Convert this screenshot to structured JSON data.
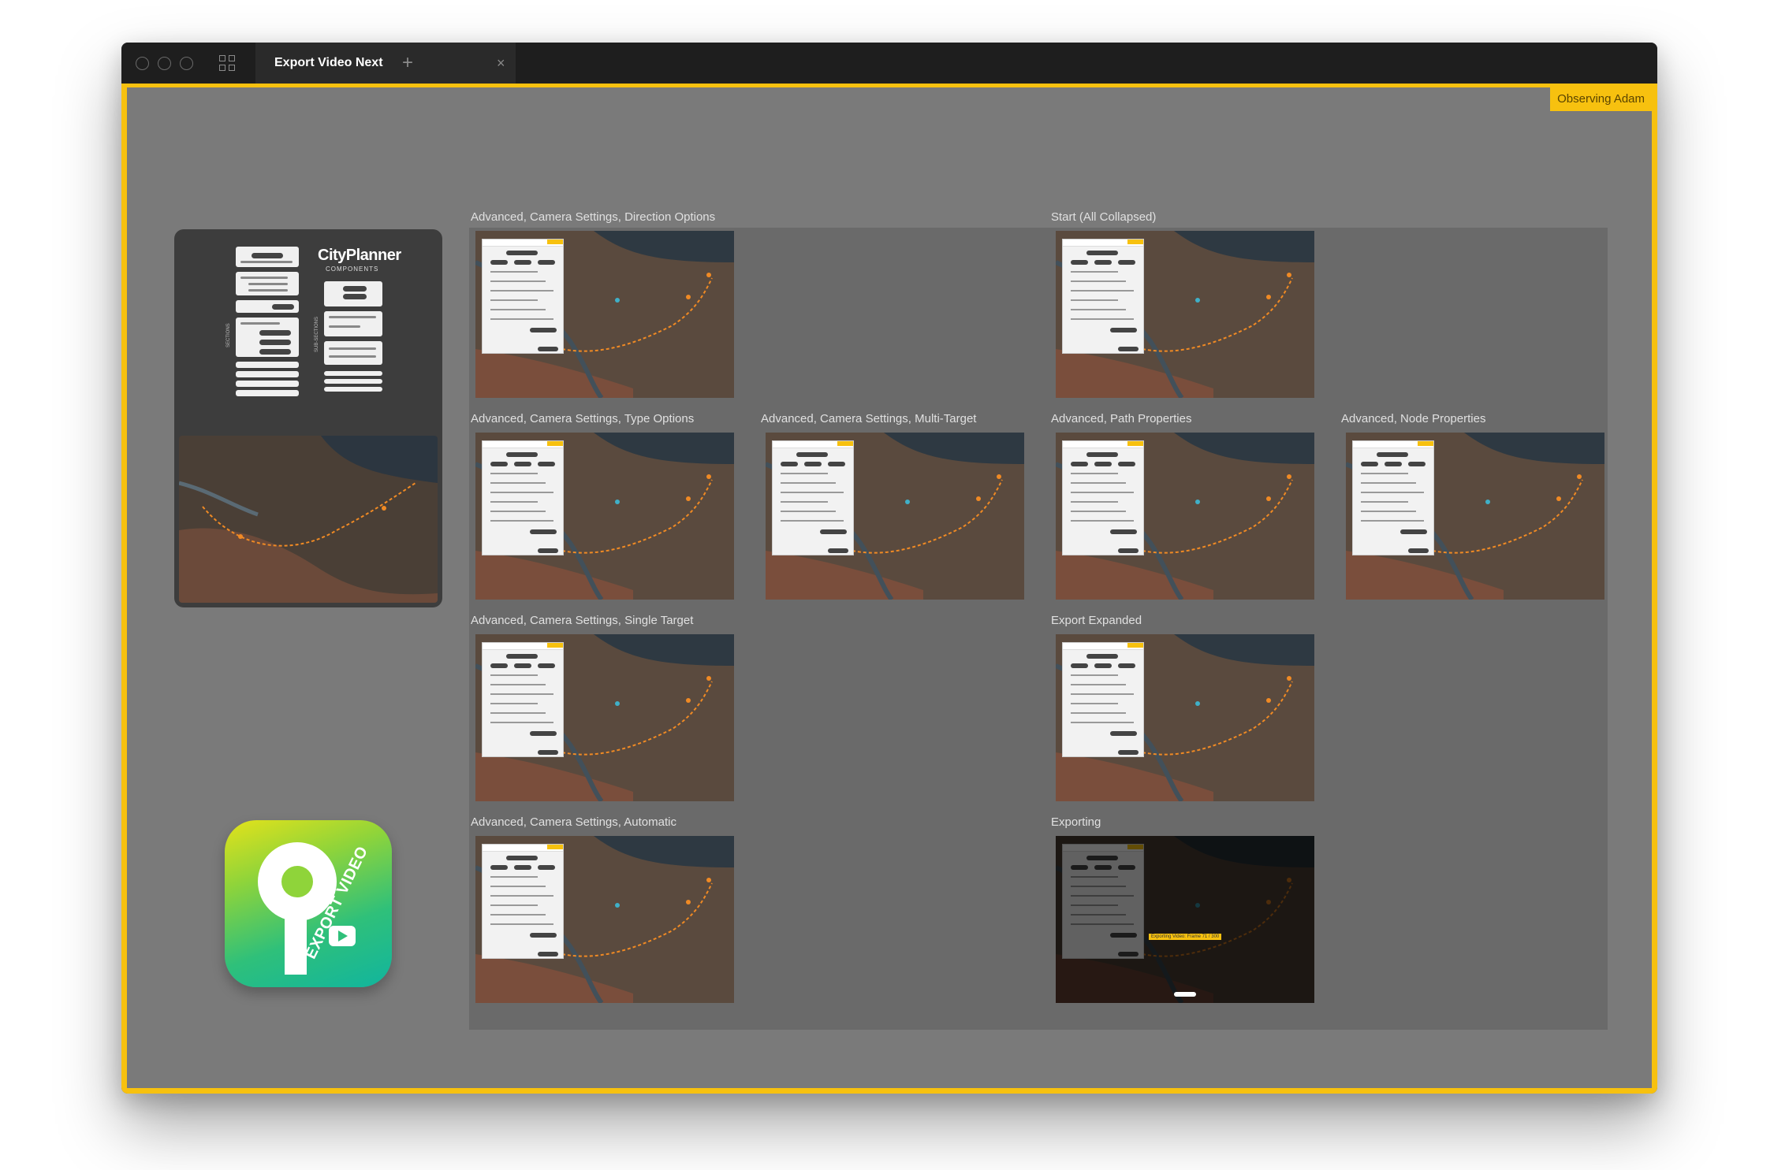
{
  "window": {
    "tab_title": "Export Video Next",
    "tab_close_glyph": "×",
    "tab_add_glyph": "+",
    "observing_label": "Observing Adam"
  },
  "components_panel": {
    "logo_text": "CityPlanner",
    "logo_sub": "COMPONENTS",
    "label_sections": "SECTIONS",
    "label_subsections": "SUB-SECTIONS"
  },
  "frames": [
    {
      "label": "Advanced, Camera Settings, Direction Options",
      "variant": "direction"
    },
    {
      "label": "Start (All Collapsed)",
      "variant": "collapsed"
    },
    {
      "label": "Advanced, Camera Settings, Type Options",
      "variant": "type"
    },
    {
      "label": "Advanced, Camera Settings, Multi-Target",
      "variant": "multi"
    },
    {
      "label": "Advanced, Path Properties",
      "variant": "path"
    },
    {
      "label": "Advanced, Node Properties",
      "variant": "node"
    },
    {
      "label": "Advanced, Camera Settings, Single Target",
      "variant": "single"
    },
    {
      "label": "Export Expanded",
      "variant": "export"
    },
    {
      "label": "Advanced, Camera Settings, Automatic",
      "variant": "automatic"
    },
    {
      "label": "Exporting",
      "variant": "exporting"
    }
  ],
  "exporting_status": "Exporting Video: Frame 71 / 300",
  "app_icon": {
    "text": "EXPORT VIDEO",
    "icon": "export-video-app-icon"
  },
  "colors": {
    "accent": "#f7c10f",
    "canvas": "#7a7a7a",
    "titlebar": "#1e1e1e",
    "path_orange": "#f08a24"
  }
}
